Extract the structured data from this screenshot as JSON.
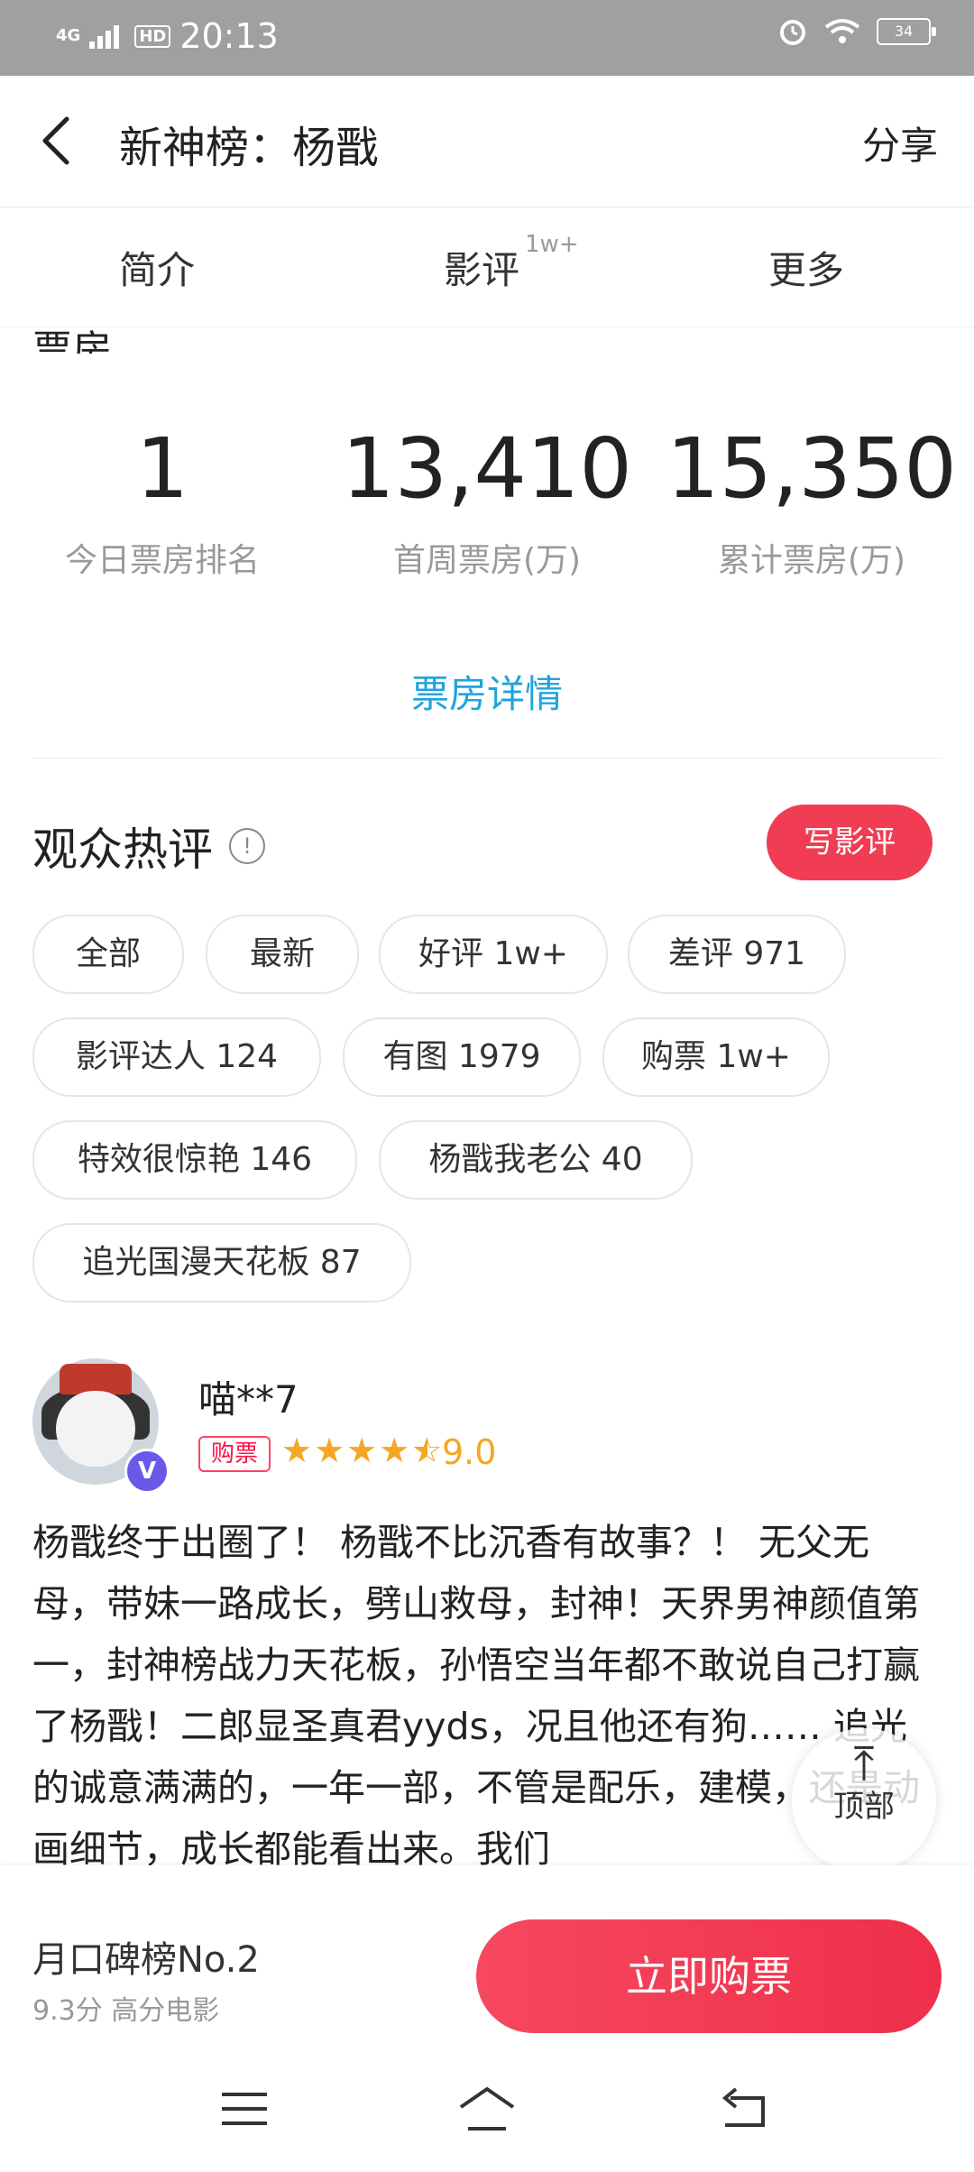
{
  "status_bar": {
    "network": "4G",
    "hd": "HD",
    "time": "20:13",
    "battery": "34",
    "icons": [
      "signal-icon",
      "alarm-icon",
      "wifi-icon",
      "battery-icon"
    ]
  },
  "header": {
    "title": "新神榜：杨戬",
    "share": "分享"
  },
  "tabs": [
    {
      "label": "简介"
    },
    {
      "label": "影评",
      "badge": "1w+"
    },
    {
      "label": "更多"
    }
  ],
  "box_office": {
    "section_title": "票房",
    "stats": [
      {
        "value": "1",
        "label": "今日票房排名"
      },
      {
        "value": "13,410",
        "label": "首周票房(万)"
      },
      {
        "value": "15,350",
        "label": "累计票房(万)"
      }
    ],
    "detail_link": "票房详情"
  },
  "comments": {
    "title": "观众热评",
    "write_button": "写影评",
    "tags": [
      "全部",
      "最新",
      "好评 1w+",
      "差评 971",
      "影评达人 124",
      "有图 1979",
      "购票 1w+",
      "特效很惊艳 146",
      "杨戬我老公 40",
      "追光国漫天花板 87"
    ],
    "first": {
      "user": "喵**7",
      "badge": "购票",
      "rating_stars": 4.5,
      "score": "9.0",
      "text": "杨戬终于出圈了！ 杨戬不比沉香有故事？！ 无父无母，带妹一路成长，劈山救母，封神！天界男神颜值第一，封神榜战力天花板，孙悟空当年都不敢说自己打赢了杨戬！二郎显圣真君yyds，况且他还有狗…… 追光的诚意满满的，一年一部，不管是配乐，建模，还是动画细节，成长都能看出来。我们"
    },
    "back_to_top": "顶部"
  },
  "bottom": {
    "rank": "月口碑榜No.2",
    "rank_sub": "9.3分 高分电影",
    "buy_button": "立即购票"
  },
  "navbar": {
    "icons": [
      "menu-icon",
      "home-icon",
      "back-icon"
    ]
  }
}
